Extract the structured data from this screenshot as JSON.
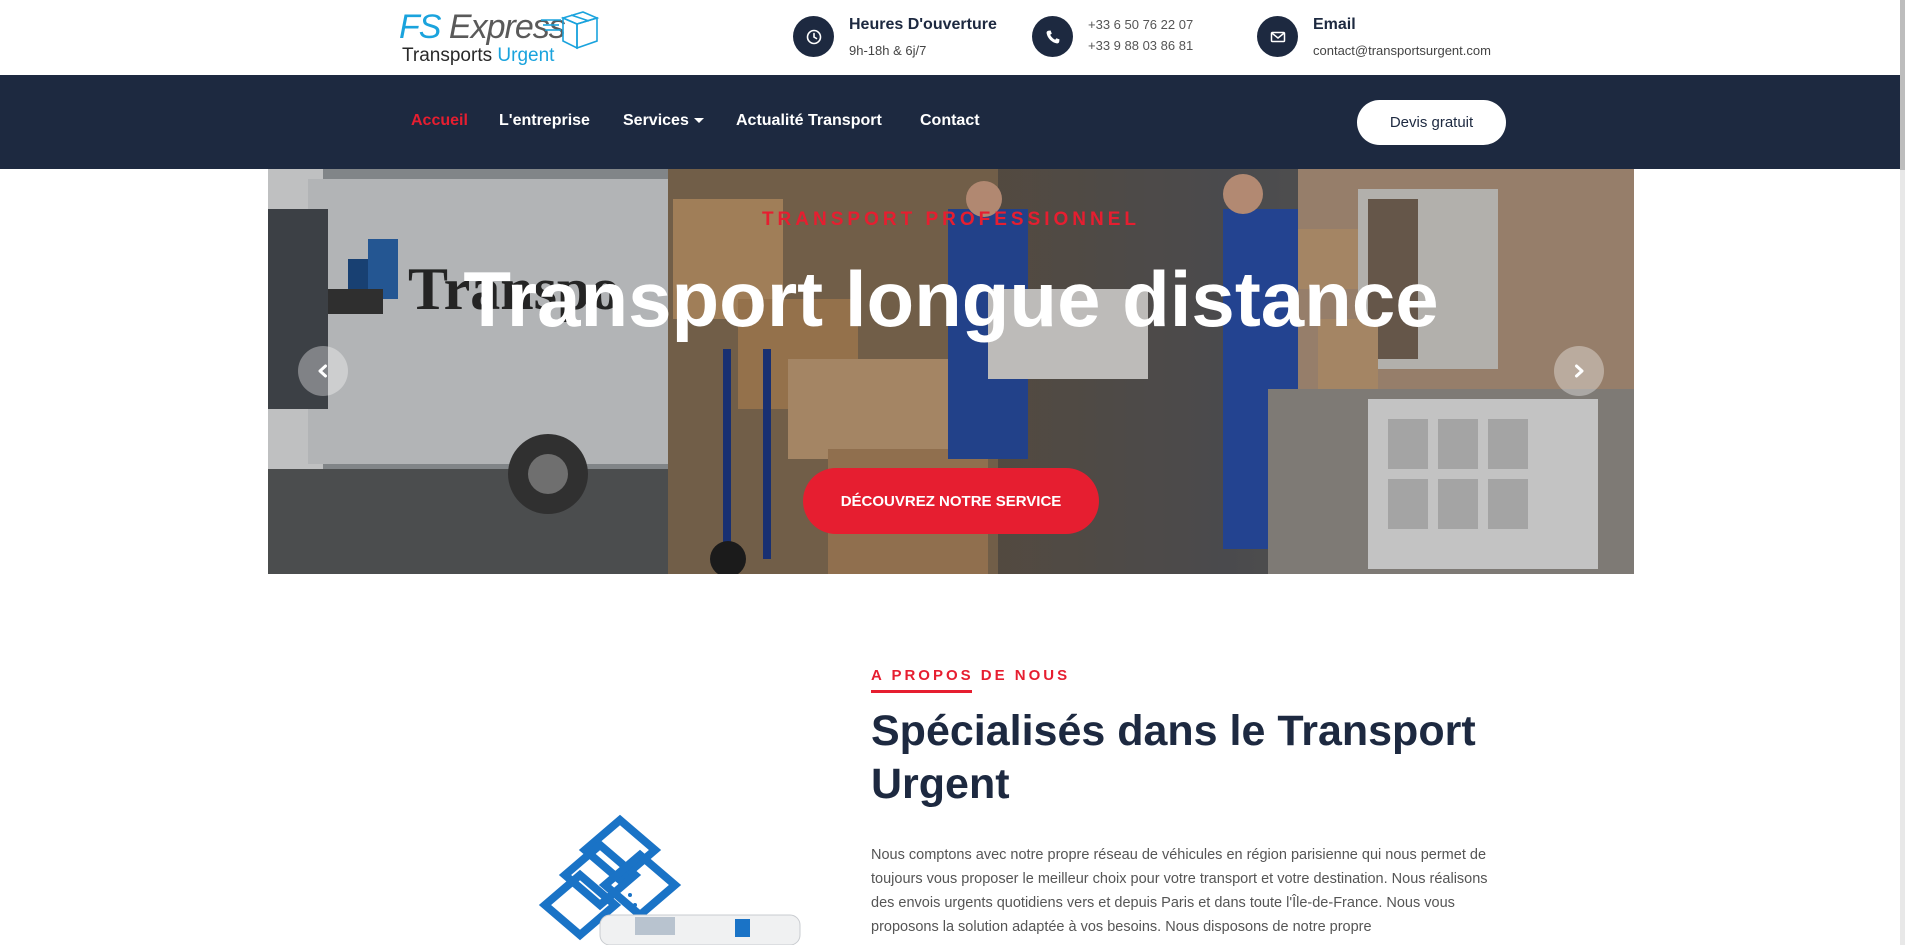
{
  "brand": {
    "logo_main": "FS ",
    "logo_main_2": "Express",
    "logo_sub": "Transports ",
    "logo_sub_2": "Urgent",
    "accent_color": "#1aa3dd",
    "logo_icon": "package-box-icon"
  },
  "contact_bar": {
    "hours_title": "Heures D'ouverture",
    "hours_value": "9h-18h & 6j/7",
    "phone_1": "+33 6 50 76 22 07",
    "phone_2": "+33 9 88 03 86 81",
    "email_title": "Email",
    "email_value": "contact@transportsurgent.com",
    "icons": [
      "clock-icon",
      "phone-icon",
      "envelope-icon"
    ]
  },
  "nav": {
    "items": [
      {
        "label": "Accueil",
        "active": true
      },
      {
        "label": "L'entreprise"
      },
      {
        "label": "Services",
        "dropdown": true
      },
      {
        "label": "Actualité Transport"
      },
      {
        "label": "Contact"
      }
    ],
    "cta_label": "Devis gratuit",
    "background": "#1d2940",
    "active_color": "#e61e30"
  },
  "hero": {
    "eyebrow": "TRANSPORT PROFESSIONNEL",
    "title": "Transport longue distance",
    "button_label": "DÉCOUVREZ NOTRE SERVICE",
    "truck_text": "Transport",
    "icons": [
      "chevron-left-icon",
      "chevron-right-icon"
    ]
  },
  "about": {
    "eyebrow": "A PROPOS DE NOUS",
    "title": "Spécialisés dans le Transport Urgent",
    "text": "Nous comptons avec notre propre réseau de véhicules en région parisienne qui nous permet de toujours vous proposer le meilleur choix pour votre transport et votre destination. Nous réalisons des envois urgents quotidiens vers et depuis Paris et dans toute l'Île-de-France. Nous vous proposons la solution adaptée à vos besoins. Nous disposons de notre propre"
  }
}
